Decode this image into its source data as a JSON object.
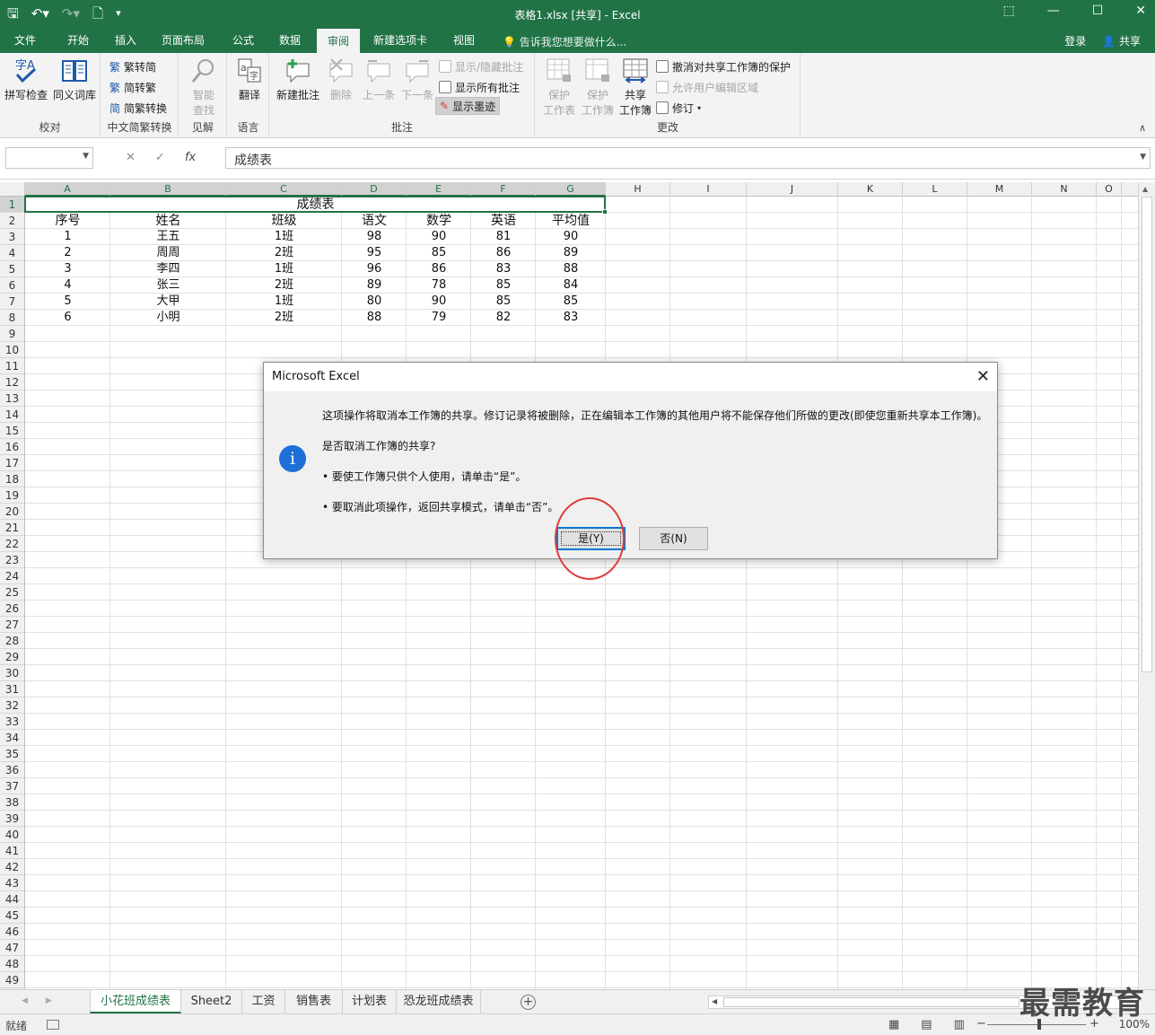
{
  "window": {
    "title": "表格1.xlsx  [共享] - Excel",
    "qat": {
      "save_icon": "save-icon",
      "undo_icon": "undo-icon",
      "redo_icon": "redo-icon",
      "new_icon": "new-file-icon",
      "customize_icon": "customize-icon"
    }
  },
  "menu": {
    "tabs": [
      "文件",
      "开始",
      "插入",
      "页面布局",
      "公式",
      "数据",
      "审阅",
      "新建选项卡",
      "视图"
    ],
    "active_tab": "审阅",
    "tell_me": "告诉我您想要做什么...",
    "login": "登录",
    "share": "共享"
  },
  "ribbon": {
    "proofing": {
      "label": "校对",
      "spell": "拼写检查",
      "thesaurus": "同义词库"
    },
    "chinese": {
      "label": "中文简繁转换",
      "to_trad": "繁转简",
      "to_simp": "简转繁",
      "convert": "简繁转换"
    },
    "insights": {
      "label": "见解",
      "smart_lookup_1": "智能",
      "smart_lookup_2": "查找"
    },
    "language": {
      "label": "语言",
      "translate": "翻译"
    },
    "comments": {
      "label": "批注",
      "new": "新建批注",
      "delete": "删除",
      "prev": "上一条",
      "next": "下一条",
      "show_hide": "显示/隐藏批注",
      "show_all": "显示所有批注",
      "show_ink": "显示墨迹"
    },
    "changes": {
      "label": "更改",
      "protect_sheet_1": "保护",
      "protect_sheet_2": "工作表",
      "protect_book_1": "保护",
      "protect_book_2": "工作簿",
      "share_book_1": "共享",
      "share_book_2": "工作簿",
      "unprotect_shared": "撤消对共享工作簿的保护",
      "allow_edit": "允许用户编辑区域",
      "track": "修订"
    }
  },
  "formula_bar": {
    "name_box": "",
    "cancel": "✕",
    "enter": "✓",
    "fx": "fx",
    "content": "成绩表"
  },
  "columns": [
    "A",
    "B",
    "C",
    "D",
    "E",
    "F",
    "G",
    "H",
    "I",
    "J",
    "K",
    "L",
    "M",
    "N",
    "O"
  ],
  "rows": [
    "1",
    "2",
    "3",
    "4",
    "5",
    "6",
    "7",
    "8",
    "9",
    "10",
    "11",
    "12",
    "13",
    "14",
    "15",
    "16",
    "17",
    "18",
    "19",
    "20",
    "21",
    "22",
    "23",
    "24",
    "25",
    "26",
    "27",
    "28",
    "29",
    "30",
    "31",
    "32",
    "33",
    "34",
    "35",
    "36",
    "37",
    "38",
    "39",
    "40",
    "41",
    "42",
    "43",
    "44",
    "45",
    "46",
    "47",
    "48",
    "49"
  ],
  "sheet": {
    "title": "成绩表",
    "headers": [
      "序号",
      "姓名",
      "班级",
      "语文",
      "数学",
      "英语",
      "平均值"
    ],
    "data": [
      [
        "1",
        "王五",
        "1班",
        "98",
        "90",
        "81",
        "90"
      ],
      [
        "2",
        "周周",
        "2班",
        "95",
        "85",
        "86",
        "89"
      ],
      [
        "3",
        "李四",
        "1班",
        "96",
        "86",
        "83",
        "88"
      ],
      [
        "4",
        "张三",
        "2班",
        "89",
        "78",
        "85",
        "84"
      ],
      [
        "5",
        "大甲",
        "1班",
        "80",
        "90",
        "85",
        "85"
      ],
      [
        "6",
        "小明",
        "2班",
        "88",
        "79",
        "82",
        "83"
      ]
    ]
  },
  "sheet_tabs": [
    "小花班成绩表",
    "Sheet2",
    "工资",
    "销售表",
    "计划表",
    "恐龙班成绩表"
  ],
  "active_sheet": "小花班成绩表",
  "status": {
    "ready": "就绪",
    "zoom": "100%"
  },
  "dialog": {
    "title": "Microsoft Excel",
    "message_1": "这项操作将取消本工作簿的共享。修订记录将被删除，正在编辑本工作簿的其他用户将不能保存他们所做的更改(即使您重新共享本工作簿)。",
    "message_2": "是否取消工作簿的共享?",
    "message_3": "• 要使工作簿只供个人使用，请单击“是”。",
    "message_4": "• 要取消此项操作，返回共享模式，请单击“否”。",
    "yes": "是(Y)",
    "no": "否(N)"
  },
  "watermark": "最需教育",
  "colors": {
    "excel_green": "#217346",
    "highlight_red": "#e23a3a",
    "info_blue": "#1d70d6"
  }
}
